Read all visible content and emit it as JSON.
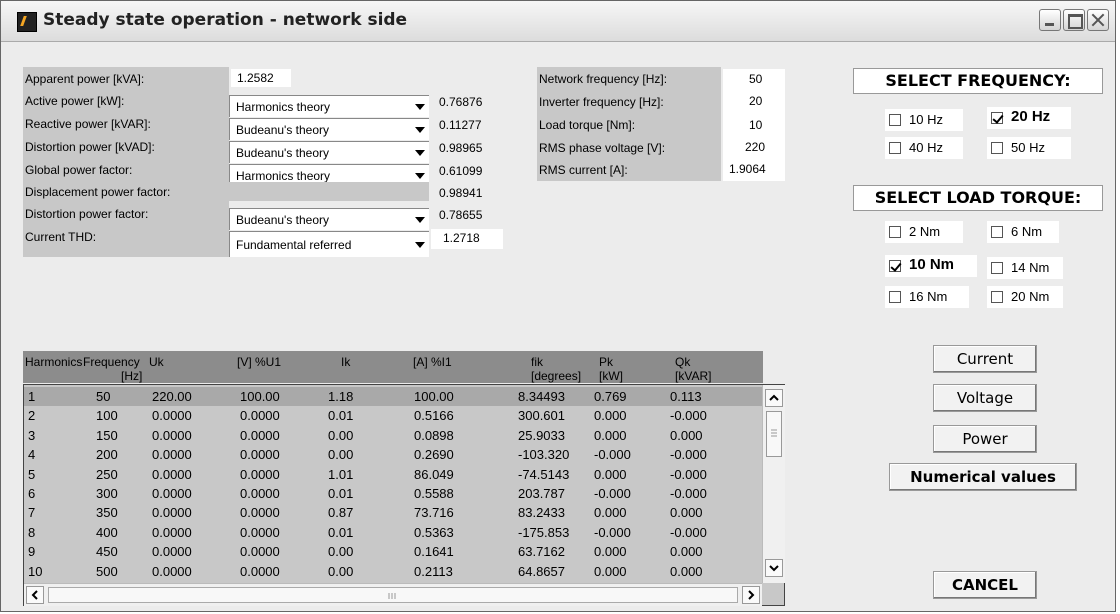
{
  "window": {
    "title": "Steady state operation - network side"
  },
  "left_panel": {
    "rows": [
      {
        "label": "Apparent power [kVA]:",
        "method": "",
        "value": "1.2582"
      },
      {
        "label": "Active power [kW]:",
        "method": "Harmonics theory",
        "value": "0.76876"
      },
      {
        "label": "Reactive power [kVAR]:",
        "method": "Budeanu's theory",
        "value": "0.11277"
      },
      {
        "label": "Distortion power [kVAD]:",
        "method": "Budeanu's theory",
        "value": "0.98965"
      },
      {
        "label": "Global power factor:",
        "method": "Harmonics theory",
        "value": "0.61099"
      },
      {
        "label": "Displacement power factor:",
        "method": "",
        "value": "0.98941"
      },
      {
        "label": "Distortion power factor:",
        "method": "Budeanu's theory",
        "value": "0.78655"
      },
      {
        "label": "Current THD:",
        "method": "Fundamental referred",
        "value": "1.2718"
      }
    ]
  },
  "mid_panel": {
    "rows": [
      {
        "label": "Network frequency [Hz]:",
        "value": "50"
      },
      {
        "label": "Inverter frequency [Hz]:",
        "value": "20"
      },
      {
        "label": "Load torque [Nm]:",
        "value": "10"
      },
      {
        "label": "RMS phase voltage [V]:",
        "value": "220"
      },
      {
        "label": "RMS current [A]:",
        "value": "1.9064"
      }
    ]
  },
  "select_frequency": {
    "title": "SELECT FREQUENCY:",
    "options": [
      {
        "label": "10 Hz",
        "checked": false
      },
      {
        "label": "20 Hz",
        "checked": true
      },
      {
        "label": "40 Hz",
        "checked": false
      },
      {
        "label": "50 Hz",
        "checked": false
      }
    ]
  },
  "select_torque": {
    "title": "SELECT LOAD TORQUE:",
    "options": [
      {
        "label": "2 Nm",
        "checked": false
      },
      {
        "label": "6 Nm",
        "checked": false
      },
      {
        "label": "10 Nm",
        "checked": true
      },
      {
        "label": "14 Nm",
        "checked": false
      },
      {
        "label": "16 Nm",
        "checked": false
      },
      {
        "label": "20 Nm",
        "checked": false
      }
    ]
  },
  "buttons": {
    "current": "Current",
    "voltage": "Voltage",
    "power": "Power",
    "numerical": "Numerical values",
    "cancel": "CANCEL"
  },
  "table": {
    "headers": {
      "harmonics": "Harmonics",
      "frequency": "Frequency",
      "frequency_unit": "[Hz]",
      "uk": "Uk",
      "v_u1": "[V] %U1",
      "ik": "Ik",
      "a_i1": "[A] %I1",
      "fik": "fik",
      "fik_unit": "[degrees]",
      "pk": "Pk",
      "pk_unit": "[kW]",
      "qk": "Qk",
      "qk_unit": "[kVAR]"
    },
    "rows": [
      [
        "1",
        "50",
        "220.00",
        "100.00",
        "1.18",
        "100.00",
        "8.34493",
        "0.769",
        "0.113"
      ],
      [
        "2",
        "100",
        "0.0000",
        "0.0000",
        "0.01",
        "0.5166",
        "300.601",
        "0.000",
        "-0.000"
      ],
      [
        "3",
        "150",
        "0.0000",
        "0.0000",
        "0.00",
        "0.0898",
        "25.9033",
        "0.000",
        "0.000"
      ],
      [
        "4",
        "200",
        "0.0000",
        "0.0000",
        "0.00",
        "0.2690",
        "-103.320",
        "-0.000",
        "-0.000"
      ],
      [
        "5",
        "250",
        "0.0000",
        "0.0000",
        "1.01",
        "86.049",
        "-74.5143",
        "0.000",
        "-0.000"
      ],
      [
        "6",
        "300",
        "0.0000",
        "0.0000",
        "0.01",
        "0.5588",
        "203.787",
        "-0.000",
        "-0.000"
      ],
      [
        "7",
        "350",
        "0.0000",
        "0.0000",
        "0.87",
        "73.716",
        "83.2433",
        "0.000",
        "0.000"
      ],
      [
        "8",
        "400",
        "0.0000",
        "0.0000",
        "0.01",
        "0.5363",
        "-175.853",
        "-0.000",
        "-0.000"
      ],
      [
        "9",
        "450",
        "0.0000",
        "0.0000",
        "0.00",
        "0.1641",
        "63.7162",
        "0.000",
        "0.000"
      ],
      [
        "10",
        "500",
        "0.0000",
        "0.0000",
        "0.00",
        "0.2113",
        "64.8657",
        "0.000",
        "0.000"
      ]
    ]
  }
}
